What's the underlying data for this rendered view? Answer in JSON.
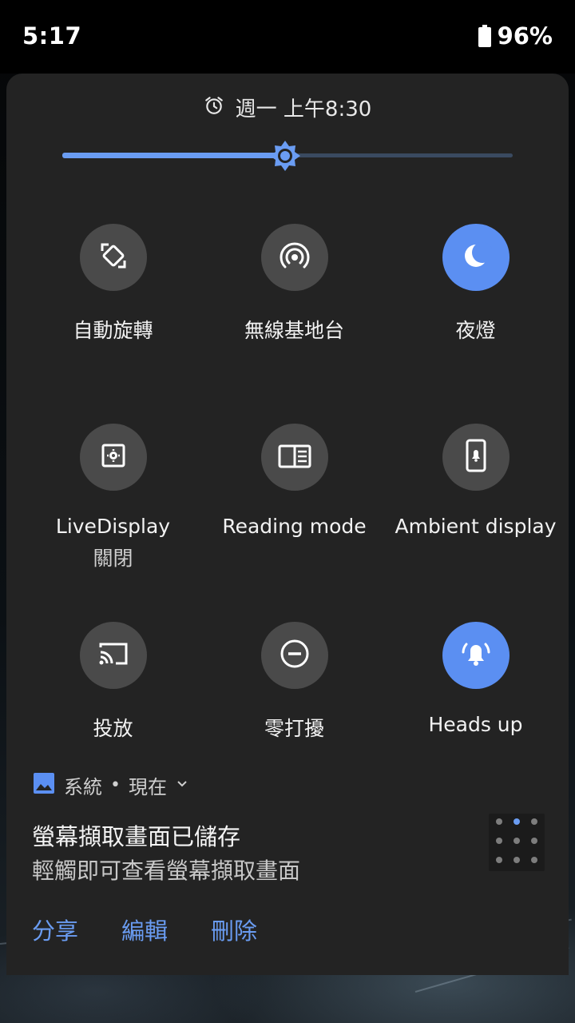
{
  "status_bar": {
    "time": "5:17",
    "battery_percent": "96%",
    "battery_level": 0.96
  },
  "alarm": {
    "icon": "alarm-clock-icon",
    "text": "週一 上午8:30"
  },
  "brightness": {
    "level": 0.495,
    "icon": "brightness-sun-icon",
    "fill_color": "#6a9cf2",
    "track_color": "#3a4a60"
  },
  "tiles": [
    {
      "id": "auto-rotate",
      "label": "自動旋轉",
      "sub": "",
      "icon": "screen-rotation-icon",
      "active": false
    },
    {
      "id": "hotspot",
      "label": "無線基地台",
      "sub": "",
      "icon": "hotspot-icon",
      "active": false
    },
    {
      "id": "night-light",
      "label": "夜燈",
      "sub": "",
      "icon": "moon-icon",
      "active": true
    },
    {
      "id": "livedisplay",
      "label": "LiveDisplay",
      "sub": "關閉",
      "icon": "livedisplay-icon",
      "active": false
    },
    {
      "id": "reading-mode",
      "label": "Reading mode",
      "sub": "",
      "icon": "reading-mode-icon",
      "active": false
    },
    {
      "id": "ambient-display",
      "label": "Ambient display",
      "sub": "",
      "icon": "ambient-display-icon",
      "active": false
    },
    {
      "id": "cast",
      "label": "投放",
      "sub": "",
      "icon": "cast-icon",
      "active": false
    },
    {
      "id": "dnd",
      "label": "零打擾",
      "sub": "",
      "icon": "do-not-disturb-icon",
      "active": false
    },
    {
      "id": "heads-up",
      "label": "Heads up",
      "sub": "",
      "icon": "bell-icon",
      "active": true
    }
  ],
  "notification": {
    "app_icon": "image-icon",
    "app_name": "系統",
    "separator": "•",
    "time": "現在",
    "expand_icon": "chevron-down-icon",
    "title": "螢幕擷取畫面已儲存",
    "text": "輕觸即可查看螢幕擷取畫面",
    "actions": [
      "分享",
      "編輯",
      "刪除"
    ]
  },
  "colors": {
    "accent": "#5b8ff2",
    "panel": "#232323",
    "tile_inactive": "#4a4a4a"
  }
}
